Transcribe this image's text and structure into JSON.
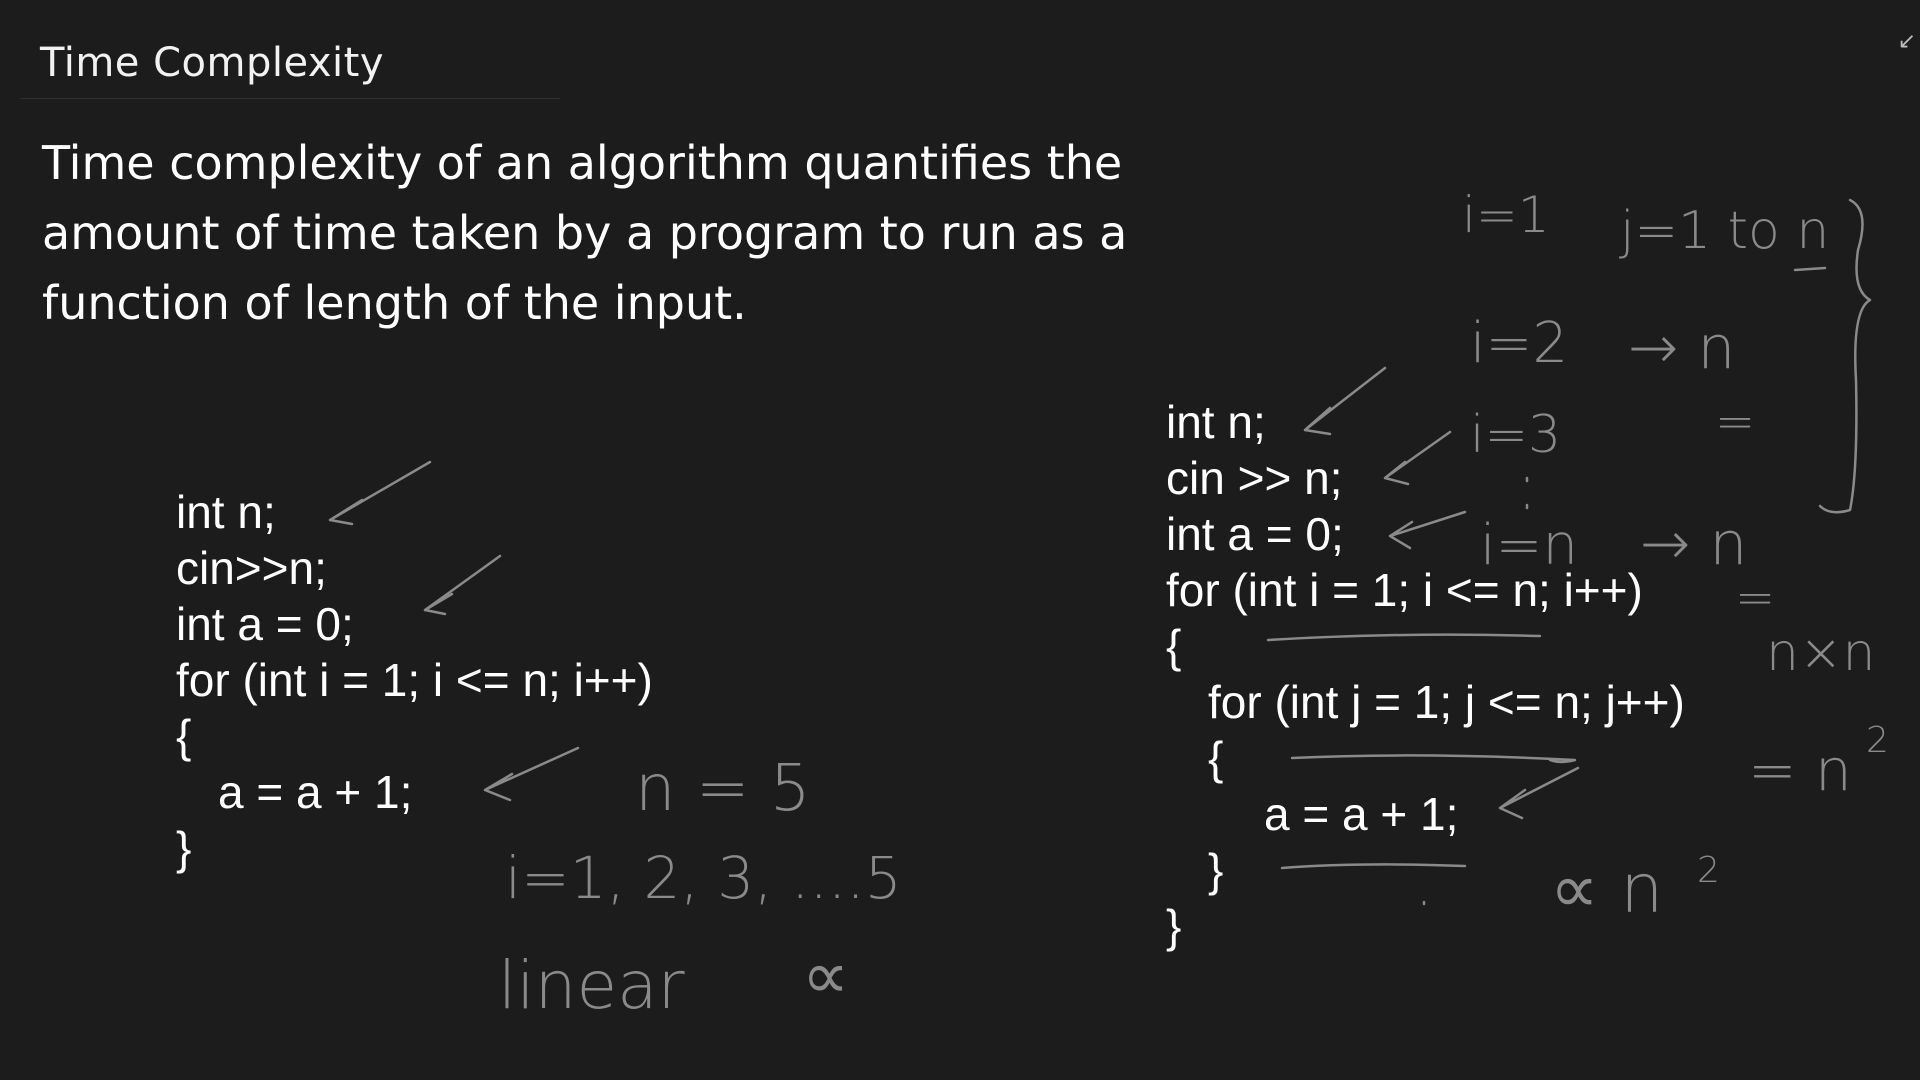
{
  "slide": {
    "title": "Time Complexity",
    "definition": "Time complexity of an algorithm quantifies the amount of time taken by a program to run as a function of length of the input."
  },
  "code_left": [
    "int n;",
    "cin>>n;",
    "int a = 0;",
    "for (int i = 1; i <= n; i++)",
    "{",
    "a = a + 1;",
    "}"
  ],
  "code_right": [
    "int n;",
    "cin >> n;",
    "int a = 0;",
    "for (int i = 1; i <= n; i++)",
    "{",
    "for (int j = 1; j <= n; j++)",
    "{",
    "a = a + 1;",
    "}",
    "}"
  ],
  "annotations": {
    "n_equals": "n = 5",
    "i_sequence": "i=1, 2, 3, ....5",
    "linear": "linear",
    "proportional_left": "∝",
    "i1": "i=1",
    "j_range": "j=1 to n",
    "i2": "i=2",
    "arrow_n": "→ n",
    "eq_a": "=",
    "i3": "i=3",
    "i_n": "i=n",
    "arrow_n2": "→ n",
    "eq_b": "=",
    "n_times_n": "n×n",
    "eq_n_squared": "= n",
    "squared_sup": "2",
    "proportional_n_squared": "∝ n",
    "squared_sup2": "2"
  },
  "icons": {
    "corner": "collapse-arrow-icon"
  },
  "colors": {
    "background": "#1c1c1c",
    "text": "#ffffff",
    "ink": "#8a8a8a"
  }
}
